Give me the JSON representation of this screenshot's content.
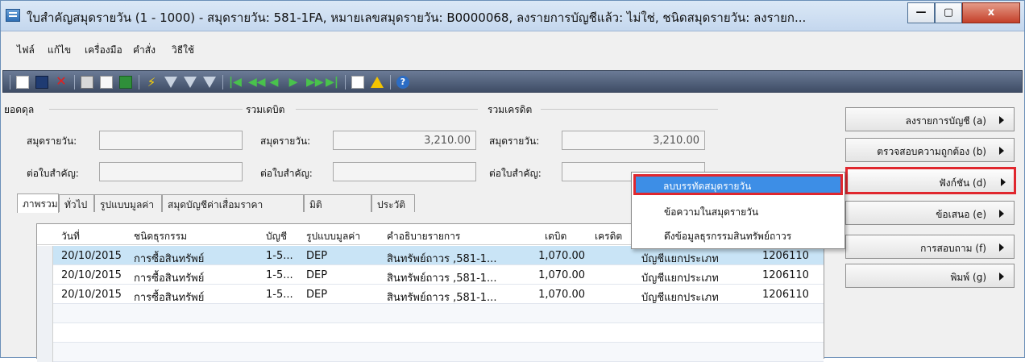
{
  "window": {
    "title": "ใบสำคัญสมุดรายวัน (1 - 1000) - สมุดรายวัน: 581-1FA, หมายเลขสมุดรายวัน: B0000068, ลงรายการบัญชีแล้ว: ไม่ใช่, ชนิดสมุดรายวัน: ลงรายก...",
    "min_label": "—",
    "max_label": "▢",
    "close_label": "x"
  },
  "menu": [
    "ไฟล์",
    "แก้ไข",
    "เครื่องมือ",
    "คำสั่ง",
    "วิธีใช้"
  ],
  "totals": {
    "balance": {
      "heading": "ยอดดุล",
      "journal_label": "สมุดรายวัน:",
      "journal_value": "",
      "voucher_label": "ต่อใบสำคัญ:",
      "voucher_value": ""
    },
    "debit": {
      "heading": "รวมเดบิต",
      "journal_label": "สมุดรายวัน:",
      "journal_value": "3,210.00",
      "voucher_label": "ต่อใบสำคัญ:",
      "voucher_value": ""
    },
    "credit": {
      "heading": "รวมเครดิต",
      "journal_label": "สมุดรายวัน:",
      "journal_value": "3,210.00",
      "voucher_label": "ต่อใบสำคัญ:",
      "voucher_value": ""
    }
  },
  "tabs": [
    "ภาพรวม",
    "ทั่วไป",
    "รูปแบบมูลค่า",
    "สมุดบัญชีค่าเสื่อมราคา",
    "มิติ",
    "ประวัติ"
  ],
  "grid": {
    "columns": [
      "วันที่",
      "ชนิดธุรกรรม",
      "บัญชี",
      "รูปแบบมูลค่า",
      "คำอธิบายรายการ",
      "เดบิต",
      "เครดิต"
    ],
    "rows": [
      {
        "date": "20/10/2015",
        "type": "การซื้อสินทรัพย์",
        "account": "1-5...",
        "model": "DEP",
        "desc": "สินทรัพย์ถาวร ,581-1...",
        "debit": "1,070.00",
        "credit": "",
        "offset_type": "บัญชีแยกประเภท",
        "offset_acct": "1206110"
      },
      {
        "date": "20/10/2015",
        "type": "การซื้อสินทรัพย์",
        "account": "1-5...",
        "model": "DEP",
        "desc": "สินทรัพย์ถาวร ,581-1...",
        "debit": "1,070.00",
        "credit": "",
        "offset_type": "บัญชีแยกประเภท",
        "offset_acct": "1206110"
      },
      {
        "date": "20/10/2015",
        "type": "การซื้อสินทรัพย์",
        "account": "1-5...",
        "model": "DEP",
        "desc": "สินทรัพย์ถาวร ,581-1...",
        "debit": "1,070.00",
        "credit": "",
        "offset_type": "บัญชีแยกประเภท",
        "offset_acct": "1206110"
      }
    ]
  },
  "popup": {
    "items": [
      "ลบบรรทัดสมุดรายวัน",
      "ข้อความในสมุดรายวัน",
      "ดึงข้อมูลธุรกรรมสินทรัพย์ถาวร"
    ]
  },
  "actions": [
    {
      "label": "ลงรายการบัญชี (a)"
    },
    {
      "label": "ตรวจสอบความถูกต้อง (b)"
    },
    {
      "label": "ฟังก์ชัน (d)"
    },
    {
      "label": "ข้อเสนอ (e)"
    },
    {
      "label": "การสอบถาม (f)"
    },
    {
      "label": "พิมพ์ (g)"
    }
  ],
  "colors": {
    "highlight": "#e0272e",
    "selected_row": "#c9e4f6",
    "popup_active": "#3d8ee6",
    "toolbar": "#4f5d78"
  },
  "icons": [
    "new-record-icon",
    "save-icon",
    "delete-icon",
    "print-icon",
    "print-preview-icon",
    "export-excel-icon",
    "filter-by-selection-icon",
    "filter-by-grid-icon",
    "advanced-filter-icon",
    "sort-filter-icon",
    "first-record-icon",
    "previous-page-icon",
    "previous-record-icon",
    "next-record-icon",
    "next-page-icon",
    "last-record-icon",
    "document-handling-icon",
    "alert-icon",
    "help-icon"
  ]
}
